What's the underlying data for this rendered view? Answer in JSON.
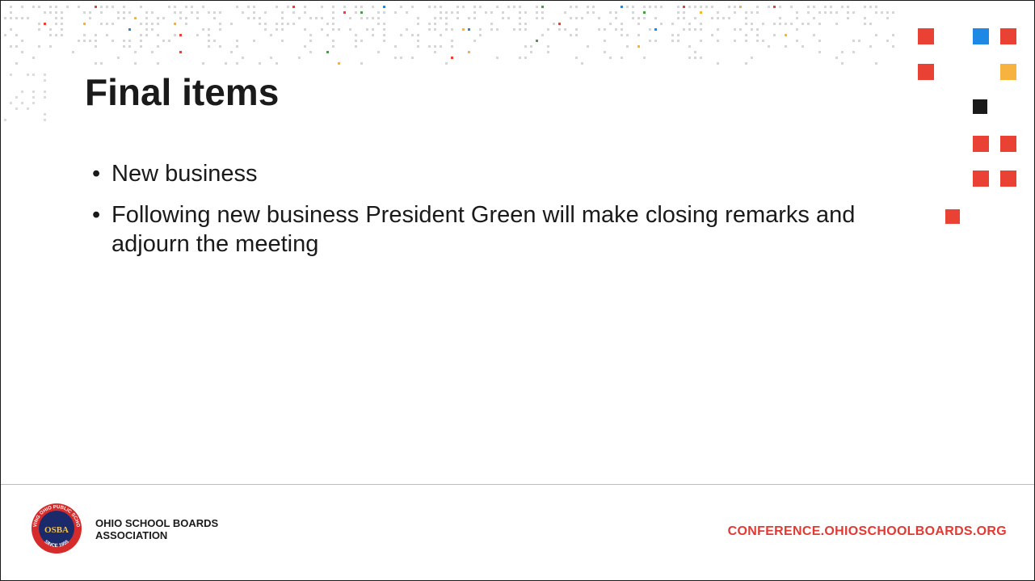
{
  "slide": {
    "title": "Final items",
    "bullets": [
      "New business",
      "Following new business President Green will make closing remarks and adjourn the meeting"
    ]
  },
  "footer": {
    "org_line1": "OHIO SCHOOL BOARDS",
    "org_line2": "ASSOCIATION",
    "url": "CONFERENCE.OHIOSCHOOLBOARDS.ORG",
    "logo": {
      "arc_text_top": "SERVING OHIO PUBLIC SCHOOLS",
      "arc_text_bottom": "SINCE 1955",
      "monogram": "OSBA"
    }
  },
  "colors": {
    "accent_red": "#e94235",
    "accent_blue": "#1e88e5",
    "accent_yellow": "#f6b33f",
    "accent_green": "#43a047",
    "dark": "#1a1a1a",
    "url_red": "#e03a33",
    "logo_red": "#d62b2b",
    "logo_navy": "#1b2a6b"
  }
}
